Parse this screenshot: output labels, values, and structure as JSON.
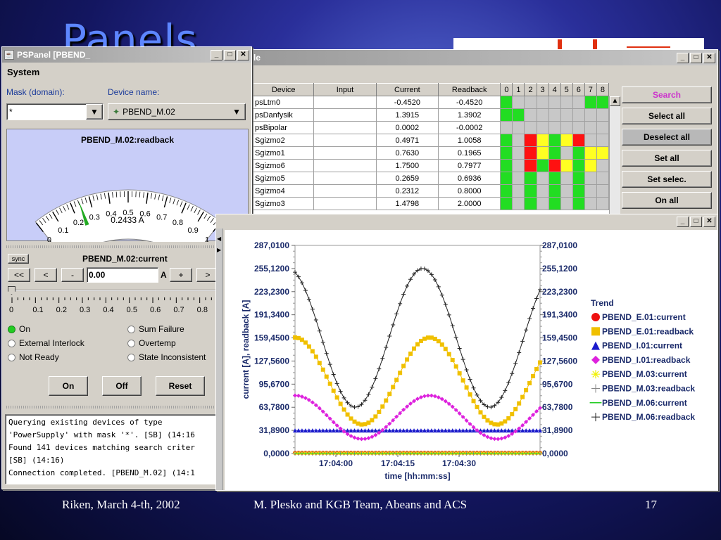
{
  "slide": {
    "title": "Panels",
    "footer_left": "Riken, March 4-th, 2002",
    "footer_center": "M. Plesko and KGB Team, Abeans and ACS",
    "footer_right": "17"
  },
  "pspanel": {
    "title": "PSPanel [PBEND_",
    "menu": "System",
    "mask_label": "Mask (domain):",
    "device_label": "Device name:",
    "mask_value": "*",
    "device_value": "PBEND_M.02",
    "gauge_title": "PBEND_M.02:readback",
    "gauge_ticks": [
      "0",
      "0.1",
      "0.2",
      "0.3",
      "0.4",
      "0.5",
      "0.6",
      "0.7",
      "0.8",
      "0.9",
      "1"
    ],
    "gauge_value": 0.2433,
    "gauge_readout": "0.2433 A",
    "sync_label": "sync",
    "current_title": "PBEND_M.02:current",
    "btn_ff_back": "<<",
    "btn_back": "<",
    "btn_minus": "-",
    "setpoint_value": "0.00",
    "unit": "A",
    "btn_plus": "+",
    "btn_fwd": ">",
    "slider_ticks": [
      "0",
      "0.1",
      "0.2",
      "0.3",
      "0.4",
      "0.5",
      "0.6",
      "0.7",
      "0.8",
      "0"
    ],
    "status": [
      {
        "label": "On",
        "on": true
      },
      {
        "label": "Sum Failure",
        "on": false
      },
      {
        "label": "External Interlock",
        "on": false
      },
      {
        "label": "Overtemp",
        "on": false
      },
      {
        "label": "Not Ready",
        "on": false
      },
      {
        "label": "State Inconsistent",
        "on": false
      }
    ],
    "btn_on": "On",
    "btn_off": "Off",
    "btn_reset": "Reset",
    "console": [
      "Querying existing devices of type",
      "'PowerSupply' with mask '*'. [SB] (14:16",
      "Found 141 devices matching search criter",
      "[SB] (14:16)",
      "Connection completed. [PBEND_M.02] (14:1"
    ]
  },
  "table_window": {
    "title": "le",
    "headers": [
      "Device",
      "Input",
      "Current",
      "Readback"
    ],
    "bit_headers": [
      "0",
      "1",
      "2",
      "3",
      "4",
      "5",
      "6",
      "7",
      "8"
    ],
    "rows": [
      {
        "device": "psLtm0",
        "input": "",
        "current": "-0.4520",
        "readback": "-0.4520",
        "bits": [
          "g",
          "n",
          "n",
          "n",
          "n",
          "n",
          "n",
          "g",
          "g"
        ]
      },
      {
        "device": "psDanfysik",
        "input": "",
        "current": "1.3915",
        "readback": "1.3902",
        "bits": [
          "g",
          "g",
          "n",
          "n",
          "n",
          "n",
          "n",
          "n",
          "n"
        ]
      },
      {
        "device": "psBipolar",
        "input": "",
        "current": "0.0002",
        "readback": "-0.0002",
        "bits": [
          "n",
          "n",
          "n",
          "n",
          "n",
          "n",
          "n",
          "n",
          "n"
        ]
      },
      {
        "device": "Sgizmo2",
        "input": "",
        "current": "0.4971",
        "readback": "1.0058",
        "bits": [
          "g",
          "n",
          "r",
          "y",
          "g",
          "y",
          "r",
          "n",
          "n"
        ]
      },
      {
        "device": "Sgizmo1",
        "input": "",
        "current": "0.7630",
        "readback": "0.1965",
        "bits": [
          "g",
          "n",
          "r",
          "y",
          "g",
          "n",
          "g",
          "y",
          "y"
        ]
      },
      {
        "device": "Sgizmo6",
        "input": "",
        "current": "1.7500",
        "readback": "0.7977",
        "bits": [
          "g",
          "n",
          "r",
          "g",
          "r",
          "y",
          "g",
          "y",
          "n"
        ]
      },
      {
        "device": "Sgizmo5",
        "input": "",
        "current": "0.2659",
        "readback": "0.6936",
        "bits": [
          "g",
          "n",
          "g",
          "n",
          "g",
          "n",
          "g",
          "n",
          "n"
        ]
      },
      {
        "device": "Sgizmo4",
        "input": "",
        "current": "0.2312",
        "readback": "0.8000",
        "bits": [
          "g",
          "n",
          "g",
          "n",
          "g",
          "n",
          "g",
          "n",
          "n"
        ]
      },
      {
        "device": "Sgizmo3",
        "input": "",
        "current": "1.4798",
        "readback": "2.0000",
        "bits": [
          "g",
          "n",
          "g",
          "n",
          "g",
          "n",
          "g",
          "n",
          "n"
        ]
      }
    ],
    "buttons": [
      "Search",
      "Select all",
      "Deselect all",
      "Set all",
      "Set selec.",
      "On all"
    ],
    "search_color": "#cc33cc"
  },
  "chart_data": {
    "type": "line",
    "title": "",
    "xlabel": "time [hh:mm:ss]",
    "ylabel": "current [A], readback [A]",
    "ylim": [
      0,
      287.01
    ],
    "y_ticks": [
      "287,0100",
      "255,1200",
      "223,2300",
      "191,3400",
      "159,4500",
      "127,5600",
      "95,6700",
      "63,7800",
      "31,8900",
      "0,0000"
    ],
    "x_ticks": [
      "17:04:00",
      "17:04:15",
      "17:04:30"
    ],
    "legend_title": "Trend",
    "legend_position": "right",
    "series": [
      {
        "name": "PBEND_E.01:current",
        "color": "#ee1111",
        "marker": "circle",
        "shape": "flat",
        "level": 1
      },
      {
        "name": "PBEND_E.01:readback",
        "color": "#f0c000",
        "marker": "square",
        "shape": "wave",
        "min": 40,
        "max": 160,
        "start": 160
      },
      {
        "name": "PBEND_I.01:current",
        "color": "#1a1acc",
        "marker": "triangle",
        "shape": "flat",
        "level": 31.9
      },
      {
        "name": "PBEND_I.01:readback",
        "color": "#dd22dd",
        "marker": "diamond",
        "shape": "wave",
        "min": 20,
        "max": 80,
        "start": 80
      },
      {
        "name": "PBEND_M.03:current",
        "color": "#f0f000",
        "marker": "star",
        "shape": "flat",
        "level": 0.5
      },
      {
        "name": "PBEND_M.03:readback",
        "color": "#888888",
        "marker": "plus",
        "shape": "flat",
        "level": 0
      },
      {
        "name": "PBEND_M.06:current",
        "color": "#22cc22",
        "marker": "line",
        "shape": "flat",
        "level": 0
      },
      {
        "name": "PBEND_M.06:readback",
        "color": "#222222",
        "marker": "plus",
        "shape": "wave",
        "min": 63.8,
        "max": 255.1,
        "start": 250
      }
    ]
  }
}
